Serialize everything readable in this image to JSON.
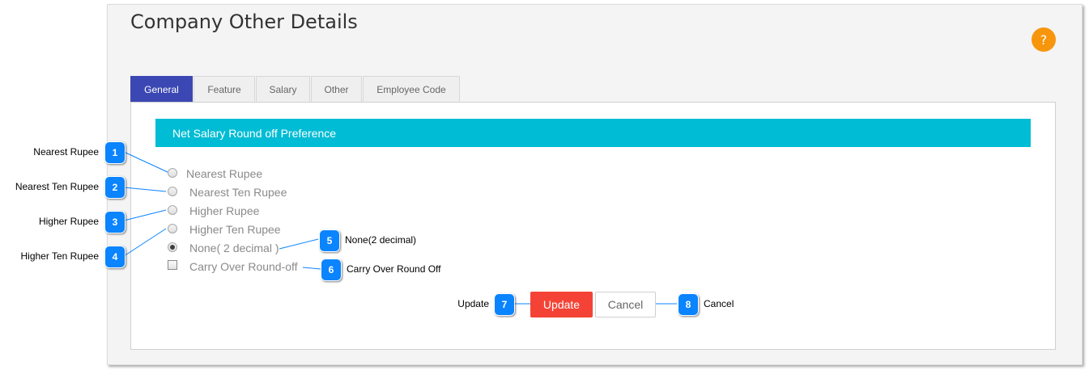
{
  "page": {
    "title": "Company Other Details",
    "help_icon": "question-icon",
    "help_label": "?"
  },
  "tabs": [
    {
      "label": "General",
      "active": true
    },
    {
      "label": "Feature",
      "active": false
    },
    {
      "label": "Salary",
      "active": false
    },
    {
      "label": "Other",
      "active": false
    },
    {
      "label": "Employee Code",
      "active": false
    }
  ],
  "section": {
    "title": "Net Salary Round off Preference"
  },
  "options": [
    {
      "label": "Nearest Rupee",
      "checked": false
    },
    {
      "label": "Nearest Ten Rupee",
      "checked": false
    },
    {
      "label": "Higher Rupee",
      "checked": false
    },
    {
      "label": "Higher Ten Rupee",
      "checked": false
    },
    {
      "label": "None( 2 decimal )",
      "checked": true
    }
  ],
  "carry_over": {
    "label": "Carry Over Round-off",
    "checked": false
  },
  "buttons": {
    "update": "Update",
    "cancel": "Cancel"
  },
  "callouts": [
    {
      "number": "1",
      "text": "Nearest Rupee"
    },
    {
      "number": "2",
      "text": "Nearest Ten Rupee"
    },
    {
      "number": "3",
      "text": "Higher Rupee"
    },
    {
      "number": "4",
      "text": "Higher Ten Rupee"
    },
    {
      "number": "5",
      "text": "None(2 decimal)"
    },
    {
      "number": "6",
      "text": "Carry Over Round Off"
    },
    {
      "number": "7",
      "text": "Update"
    },
    {
      "number": "8",
      "text": "Cancel"
    }
  ],
  "colors": {
    "tab_active": "#3b48b3",
    "section_bar": "#00bcd4",
    "update_button": "#f44336",
    "help_icon": "#f7960c",
    "callout_badge": "#0a84ff"
  }
}
